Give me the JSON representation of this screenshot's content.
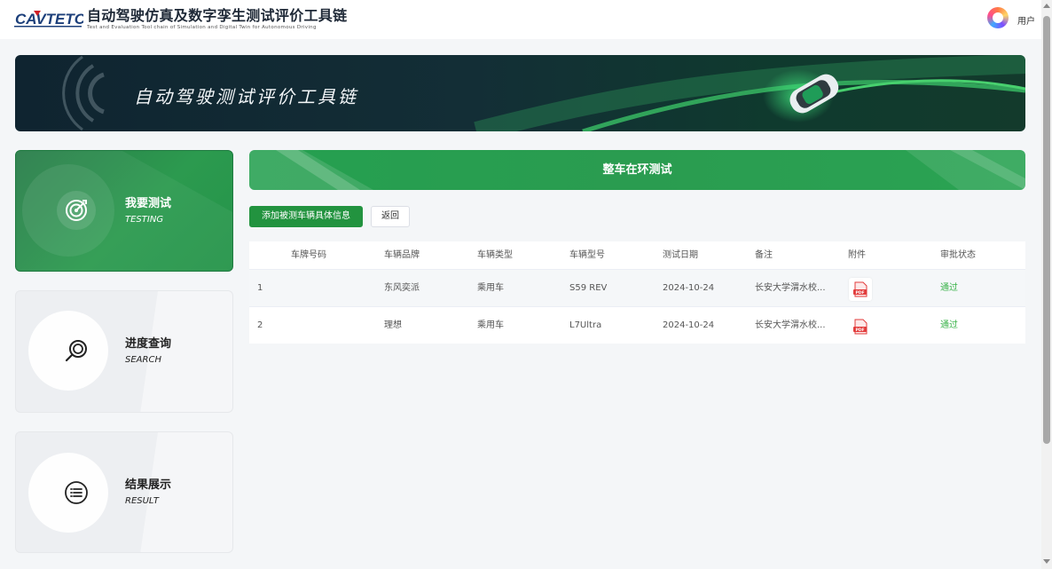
{
  "header": {
    "logo_text": "CAVTETC",
    "title": "自动驾驶仿真及数字孪生测试评价工具链",
    "subtitle": "Test and Evaluation Tool chain of Simulation and Digital Twin for Autonomous Driving",
    "user_label": "用户"
  },
  "banner": {
    "title": "自动驾驶测试评价工具链"
  },
  "nav": {
    "items": [
      {
        "title": "我要测试",
        "en": "TESTING",
        "icon": "target-icon",
        "active": true
      },
      {
        "title": "进度查询",
        "en": "SEARCH",
        "icon": "search-icon",
        "active": false
      },
      {
        "title": "结果展示",
        "en": "RESULT",
        "icon": "list-icon",
        "active": false
      }
    ]
  },
  "section": {
    "title": "整车在环测试"
  },
  "toolbar": {
    "add_label": "添加被测车辆具体信息",
    "back_label": "返回"
  },
  "table": {
    "columns": [
      "车牌号码",
      "车辆品牌",
      "车辆类型",
      "车辆型号",
      "测试日期",
      "备注",
      "附件",
      "审批状态"
    ],
    "rows": [
      {
        "index": "1",
        "plate": "",
        "brand": "东风奕派",
        "type": "乘用车",
        "model": "S59 REV",
        "date": "2024-10-24",
        "note": "长安大学渭水校...",
        "attachment": "pdf-icon",
        "status": "通过"
      },
      {
        "index": "2",
        "plate": "",
        "brand": "理想",
        "type": "乘用车",
        "model": "L7Ultra",
        "date": "2024-10-24",
        "note": "长安大学渭水校...",
        "attachment": "pdf-icon",
        "status": "通过"
      }
    ]
  },
  "colors": {
    "primary_green": "#22933f",
    "status_green": "#3bb34a",
    "banner_dark": "#0f2430"
  }
}
